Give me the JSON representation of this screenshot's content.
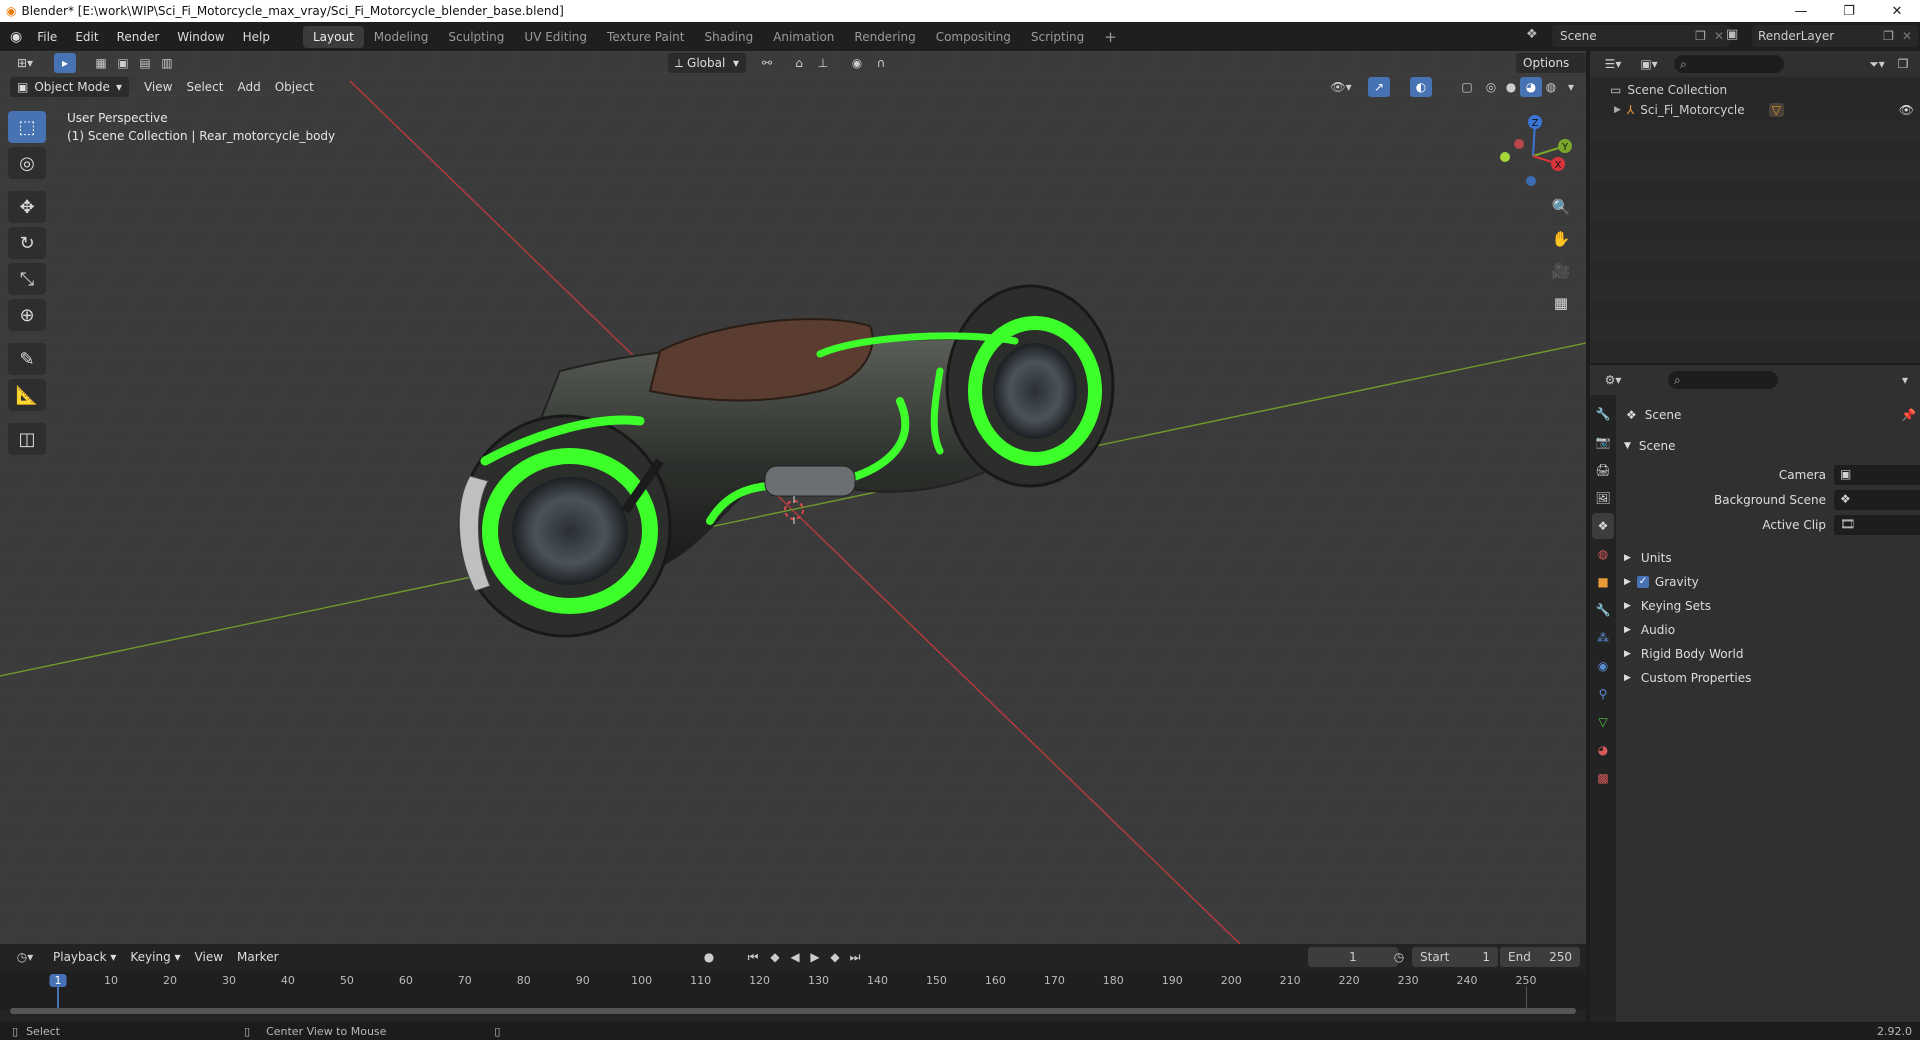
{
  "window": {
    "title": "Blender* [E:\\work\\WIP\\Sci_Fi_Motorcycle_max_vray/Sci_Fi_Motorcycle_blender_base.blend]",
    "min_icon": "minimize-icon",
    "max_icon": "restore-icon",
    "close_icon": "close-icon"
  },
  "menu": {
    "items": [
      "File",
      "Edit",
      "Render",
      "Window",
      "Help"
    ]
  },
  "workspaces": {
    "tabs": [
      "Layout",
      "Modeling",
      "Sculpting",
      "UV Editing",
      "Texture Paint",
      "Shading",
      "Animation",
      "Rendering",
      "Compositing",
      "Scripting"
    ],
    "active": "Layout",
    "add": "+"
  },
  "scene_selector": {
    "value": "Scene"
  },
  "layer_selector": {
    "value": "RenderLayer"
  },
  "viewport_header": {
    "mode": "Object Mode",
    "menus": [
      "View",
      "Select",
      "Add",
      "Object"
    ],
    "transform_orientation": "Global",
    "options": "Options"
  },
  "viewport_info": {
    "line1": "User Perspective",
    "line2": "(1) Scene Collection | Rear_motorcycle_body"
  },
  "gizmo": {
    "z": "Z",
    "y": "Y",
    "x": "X"
  },
  "outliner": {
    "root": "Scene Collection",
    "items": [
      {
        "name": "Sci_Fi_Motorcycle"
      }
    ]
  },
  "properties": {
    "context": "Scene",
    "panel_title": "Scene",
    "fields": [
      {
        "label": "Camera",
        "value": ""
      },
      {
        "label": "Background Scene",
        "value": ""
      },
      {
        "label": "Active Clip",
        "value": ""
      }
    ],
    "subpanels": [
      "Units",
      "Gravity",
      "Keying Sets",
      "Audio",
      "Rigid Body World",
      "Custom Properties"
    ],
    "gravity_checked": true
  },
  "timeline": {
    "menus": [
      "Playback",
      "Keying",
      "View",
      "Marker"
    ],
    "current_frame": "1",
    "start_label": "Start",
    "start": "1",
    "end_label": "End",
    "end": "250",
    "ticks": [
      "1",
      "10",
      "20",
      "30",
      "40",
      "50",
      "60",
      "70",
      "80",
      "90",
      "100",
      "110",
      "120",
      "130",
      "140",
      "150",
      "160",
      "170",
      "180",
      "190",
      "200",
      "210",
      "220",
      "230",
      "240",
      "250"
    ]
  },
  "status": {
    "left": "Select",
    "middle": "Center View to Mouse",
    "version": "2.92.0"
  },
  "colors": {
    "accent": "#4772b3",
    "neon": "#3dff2a",
    "x_axis": "#c0353a",
    "y_axis": "#7a9d2e"
  }
}
